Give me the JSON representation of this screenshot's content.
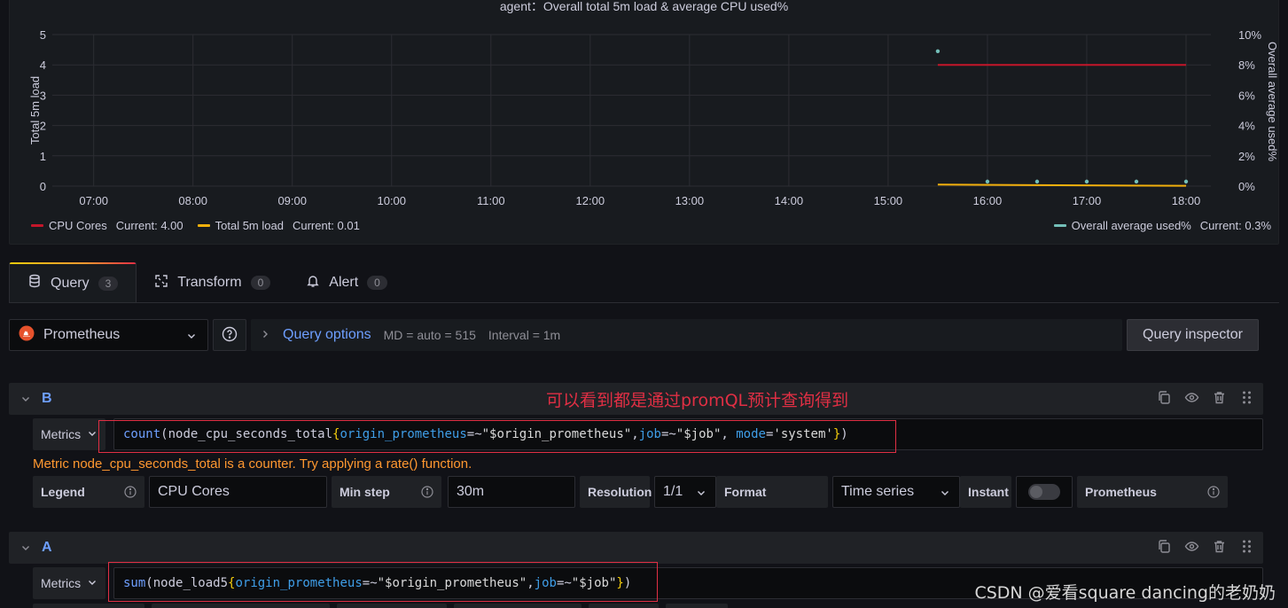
{
  "panel": {
    "title": "agent：Overall total 5m load & average CPU used%",
    "legend_left": [
      {
        "name": "CPU Cores",
        "current": "Current: 4.00",
        "color": "#c4162a"
      },
      {
        "name": "Total 5m load",
        "current": "Current: 0.01",
        "color": "#f2b00c"
      }
    ],
    "legend_right": {
      "name": "Overall average used%",
      "current": "Current: 0.3%",
      "color": "#73bfb8"
    }
  },
  "chart_data": {
    "type": "line",
    "title": "agent：Overall total 5m load & average CPU used%",
    "ylabel": "Total 5m load",
    "y2label": "Overall average used%",
    "ylim": [
      0,
      5
    ],
    "y2lim": [
      0,
      10
    ],
    "yticks": [
      "0",
      "1",
      "2",
      "3",
      "4",
      "5"
    ],
    "y2ticks": [
      "0%",
      "2%",
      "4%",
      "6%",
      "8%",
      "10%"
    ],
    "xticks": [
      "07:00",
      "08:00",
      "09:00",
      "10:00",
      "11:00",
      "12:00",
      "13:00",
      "14:00",
      "15:00",
      "16:00",
      "17:00",
      "18:00"
    ],
    "grid": true,
    "series": [
      {
        "name": "CPU Cores",
        "axis": "left",
        "color": "#c4162a",
        "style": "line",
        "x": [
          "15:30",
          "18:00"
        ],
        "values": [
          4.0,
          4.0
        ]
      },
      {
        "name": "Total 5m load",
        "axis": "left",
        "color": "#f2b00c",
        "style": "line",
        "x": [
          "15:30",
          "18:00"
        ],
        "values": [
          0.05,
          0.01
        ]
      },
      {
        "name": "Overall average used%",
        "axis": "right",
        "color": "#73bfb8",
        "style": "points",
        "x": [
          "15:30",
          "16:00",
          "16:30",
          "17:00",
          "17:30",
          "18:00"
        ],
        "values": [
          8.9,
          0.3,
          0.3,
          0.3,
          0.3,
          0.3
        ]
      }
    ]
  },
  "tabs": [
    {
      "label": "Query",
      "count": "3",
      "icon": "database-icon"
    },
    {
      "label": "Transform",
      "count": "0",
      "icon": "transform-icon"
    },
    {
      "label": "Alert",
      "count": "0",
      "icon": "bell-icon"
    }
  ],
  "datasource": {
    "name": "Prometheus"
  },
  "query_options": {
    "label": "Query options",
    "md": "MD = auto = 515",
    "interval": "Interval = 1m"
  },
  "query_inspector": "Query inspector",
  "annotation": "可以看到都是通过promQL预计查询得到",
  "queries": [
    {
      "refid": "B",
      "metrics_label": "Metrics",
      "expr": {
        "fn": "count",
        "metric": "node_cpu_seconds_total",
        "l1": "origin_prometheus",
        "op1": "=~",
        "v1": "\"$origin_prometheus\"",
        "l2": "job",
        "op2": "=~",
        "v2": "\"$job\"",
        "l3": "mode",
        "op3": "=",
        "v3": "'system'"
      },
      "warning": "Metric node_cpu_seconds_total is a counter. Try applying a rate() function.",
      "legend_label": "Legend",
      "legend_value": "CPU Cores",
      "minstep_label": "Min step",
      "minstep_value": "30m",
      "resolution_label": "Resolution",
      "resolution_value": "1/1",
      "format_label": "Format",
      "format_value": "Time series",
      "instant_label": "Instant",
      "instant_on": false,
      "source_label": "Prometheus"
    },
    {
      "refid": "A",
      "metrics_label": "Metrics",
      "expr": {
        "fn": "sum",
        "metric": "node_load5",
        "l1": "origin_prometheus",
        "op1": "=~",
        "v1": "\"$origin_prometheus\"",
        "l2": "job",
        "op2": "=~",
        "v2": "\"$job\""
      }
    }
  ],
  "watermark": "CSDN @爱看square dancing的老奶奶"
}
